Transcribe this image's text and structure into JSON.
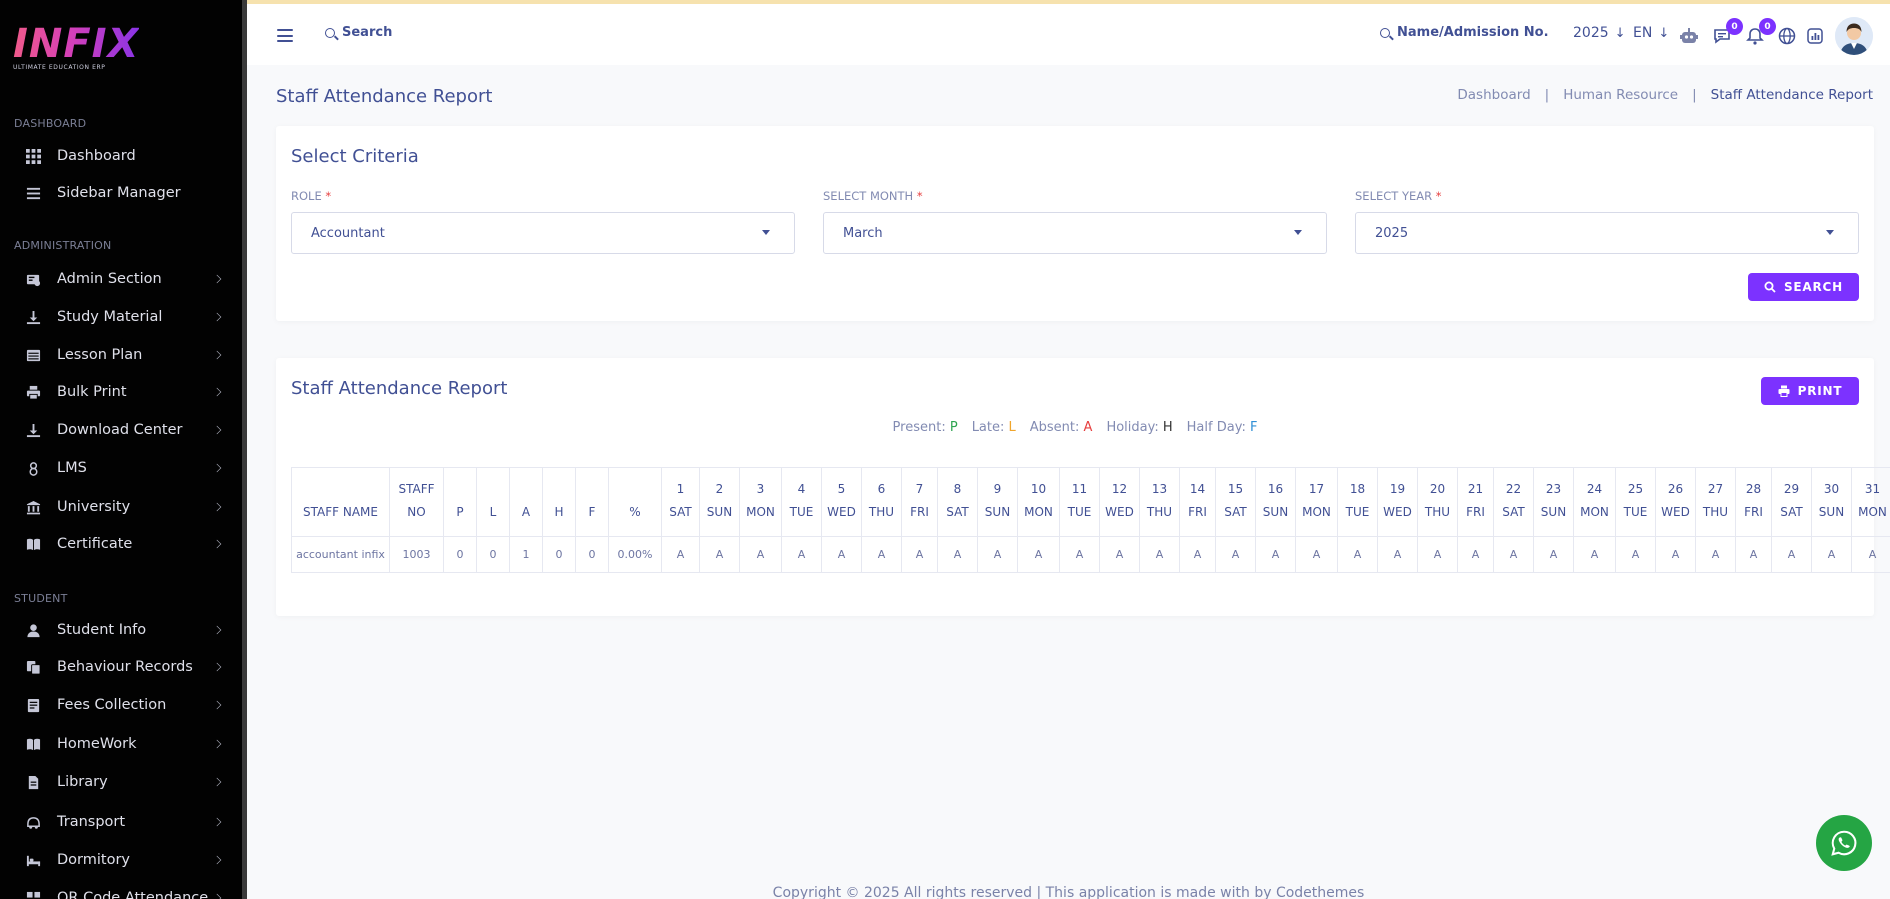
{
  "brand": {
    "name": "INFIX",
    "tagline": "ULTIMATE EDUCATION ERP"
  },
  "sidebar": {
    "sections": [
      "DASHBOARD",
      "ADMINISTRATION",
      "STUDENT"
    ],
    "items": [
      {
        "label": "Dashboard",
        "icon": "dashboard-icon"
      },
      {
        "label": "Sidebar Manager",
        "icon": "list-icon"
      },
      {
        "label": "Admin Section",
        "icon": "admin-icon"
      },
      {
        "label": "Study Material",
        "icon": "download-icon"
      },
      {
        "label": "Lesson Plan",
        "icon": "table-icon"
      },
      {
        "label": "Bulk Print",
        "icon": "printer-icon"
      },
      {
        "label": "Download Center",
        "icon": "download-icon"
      },
      {
        "label": "LMS",
        "icon": "lms-icon"
      },
      {
        "label": "University",
        "icon": "university-icon"
      },
      {
        "label": "Certificate",
        "icon": "book-icon"
      },
      {
        "label": "Student Info",
        "icon": "user-icon"
      },
      {
        "label": "Behaviour Records",
        "icon": "records-icon"
      },
      {
        "label": "Fees Collection",
        "icon": "fees-icon"
      },
      {
        "label": "HomeWork",
        "icon": "book-icon"
      },
      {
        "label": "Library",
        "icon": "library-icon"
      },
      {
        "label": "Transport",
        "icon": "transport-icon"
      },
      {
        "label": "Dormitory",
        "icon": "bed-icon"
      },
      {
        "label": "QR Code Attendance",
        "icon": "qr-icon"
      }
    ]
  },
  "header": {
    "search_label": "Search",
    "name_search_label": "Name/Admission No.",
    "year": "2025",
    "language": "EN",
    "message_count": "0",
    "notification_count": "0"
  },
  "page": {
    "title": "Staff Attendance Report",
    "breadcrumb": [
      "Dashboard",
      "Human Resource",
      "Staff Attendance Report"
    ]
  },
  "criteria": {
    "title": "Select Criteria",
    "role_label": "ROLE",
    "role_value": "Accountant",
    "month_label": "SELECT MONTH",
    "month_value": "March",
    "year_label": "SELECT YEAR",
    "year_value": "2025",
    "search_button": "SEARCH"
  },
  "report": {
    "title": "Staff Attendance Report",
    "print_button": "PRINT",
    "legend": [
      {
        "label": "Present:",
        "code": "P",
        "color": "#2ea44f"
      },
      {
        "label": "Late:",
        "code": "L",
        "color": "#f0a52c"
      },
      {
        "label": "Absent:",
        "code": "A",
        "color": "#e63e3e"
      },
      {
        "label": "Holiday:",
        "code": "H",
        "color": "#333333"
      },
      {
        "label": "Half Day:",
        "code": "F",
        "color": "#2f8fd6"
      }
    ],
    "columns": {
      "staff_name": "STAFF NAME",
      "staff_no_line1": "STAFF",
      "staff_no_line2": "NO",
      "totals": [
        "P",
        "L",
        "A",
        "H",
        "F",
        "%"
      ]
    },
    "days": [
      {
        "d": "1",
        "w": "SAT"
      },
      {
        "d": "2",
        "w": "SUN"
      },
      {
        "d": "3",
        "w": "MON"
      },
      {
        "d": "4",
        "w": "TUE"
      },
      {
        "d": "5",
        "w": "WED"
      },
      {
        "d": "6",
        "w": "THU"
      },
      {
        "d": "7",
        "w": "FRI"
      },
      {
        "d": "8",
        "w": "SAT"
      },
      {
        "d": "9",
        "w": "SUN"
      },
      {
        "d": "10",
        "w": "MON"
      },
      {
        "d": "11",
        "w": "TUE"
      },
      {
        "d": "12",
        "w": "WED"
      },
      {
        "d": "13",
        "w": "THU"
      },
      {
        "d": "14",
        "w": "FRI"
      },
      {
        "d": "15",
        "w": "SAT"
      },
      {
        "d": "16",
        "w": "SUN"
      },
      {
        "d": "17",
        "w": "MON"
      },
      {
        "d": "18",
        "w": "TUE"
      },
      {
        "d": "19",
        "w": "WED"
      },
      {
        "d": "20",
        "w": "THU"
      },
      {
        "d": "21",
        "w": "FRI"
      },
      {
        "d": "22",
        "w": "SAT"
      },
      {
        "d": "23",
        "w": "SUN"
      },
      {
        "d": "24",
        "w": "MON"
      },
      {
        "d": "25",
        "w": "TUE"
      },
      {
        "d": "26",
        "w": "WED"
      },
      {
        "d": "27",
        "w": "THU"
      },
      {
        "d": "28",
        "w": "FRI"
      },
      {
        "d": "29",
        "w": "SAT"
      },
      {
        "d": "30",
        "w": "SUN"
      },
      {
        "d": "31",
        "w": "MON"
      }
    ],
    "rows": [
      {
        "name": "accountant infix",
        "staff_no": "1003",
        "totals": [
          "0",
          "0",
          "1",
          "0",
          "0",
          "0.00%"
        ],
        "marks": [
          "A",
          "A",
          "A",
          "A",
          "A",
          "A",
          "A",
          "A",
          "A",
          "A",
          "A",
          "A",
          "A",
          "A",
          "A",
          "A",
          "A",
          "A",
          "A",
          "A",
          "A",
          "A",
          "A",
          "A",
          "A",
          "A",
          "A",
          "A",
          "A",
          "A",
          "A"
        ]
      }
    ]
  },
  "footer": {
    "text": "Copyright © 2025 All rights reserved | This application is made with by Codethemes"
  }
}
